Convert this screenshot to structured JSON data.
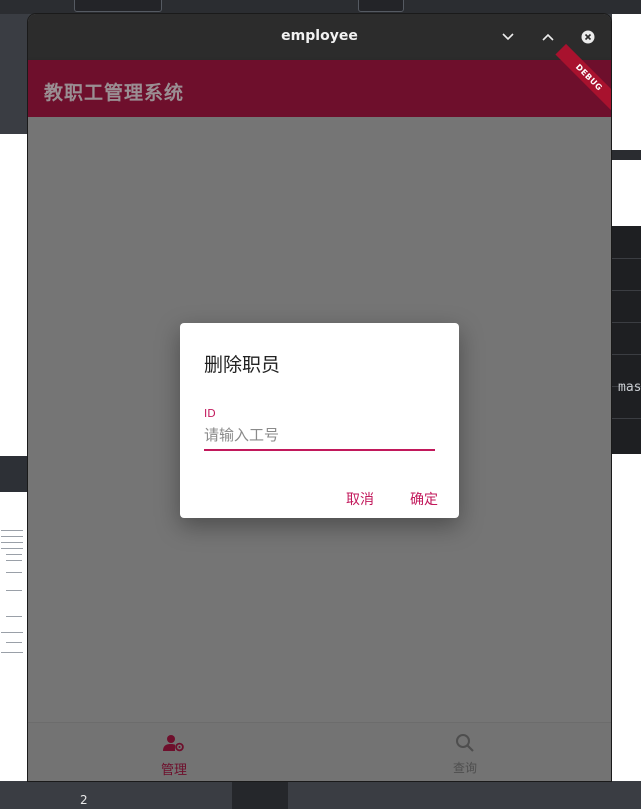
{
  "window": {
    "title": "employee"
  },
  "app": {
    "title": "教职工管理系统",
    "debug_banner": "DEBUG",
    "accent_color": "#6e0f2c"
  },
  "dialog": {
    "title": "删除职员",
    "field_label": "ID",
    "field_placeholder": "请输入工号",
    "cancel_label": "取消",
    "confirm_label": "确定",
    "accent_color": "#c2185b"
  },
  "bottom_nav": {
    "items": [
      {
        "label": "管理",
        "icon": "manage-users-icon",
        "active": true
      },
      {
        "label": "查询",
        "icon": "search-icon",
        "active": false
      }
    ]
  },
  "background": {
    "right_text": "mas",
    "page_number": "2"
  }
}
